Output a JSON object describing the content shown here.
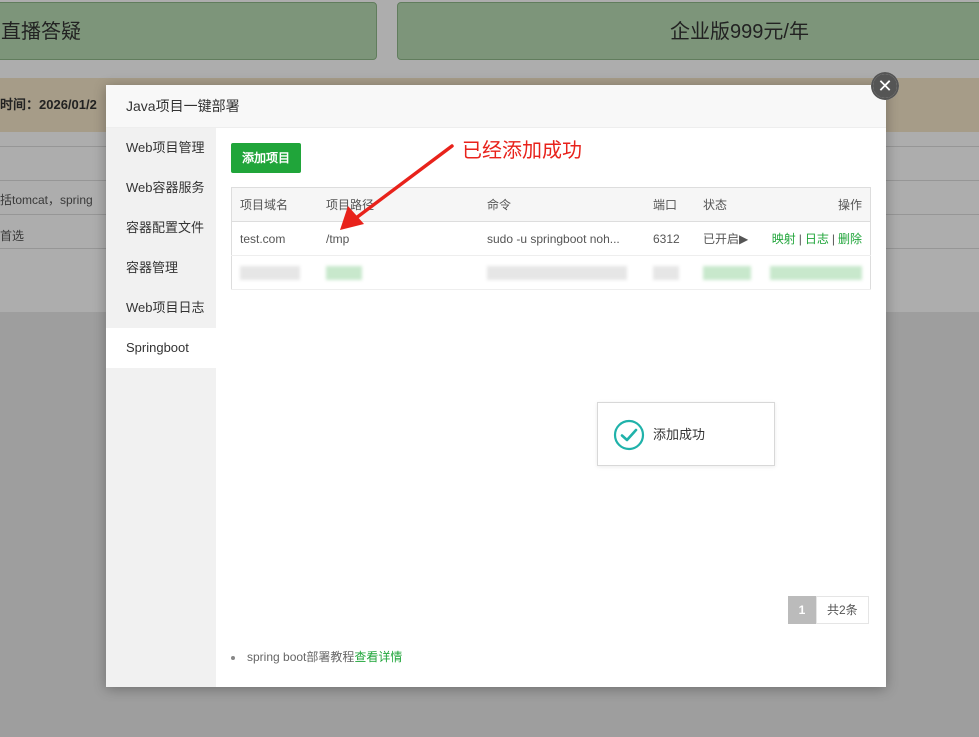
{
  "background": {
    "card1_text": "直播答疑",
    "card2_text": "企业版999元/年",
    "notice_text": "时间：2026/01/2",
    "row1_text": "括tomcat，spring",
    "row2_text": "首选"
  },
  "modal": {
    "title": "Java项目一键部署",
    "close_glyph": "✕"
  },
  "sidebar": {
    "items": [
      {
        "label": "Web项目管理"
      },
      {
        "label": "Web容器服务"
      },
      {
        "label": "容器配置文件"
      },
      {
        "label": "容器管理"
      },
      {
        "label": "Web项目日志"
      },
      {
        "label": "Springboot"
      }
    ],
    "active_index": 5
  },
  "toolbar": {
    "add_label": "添加项目"
  },
  "table": {
    "headers": {
      "domain": "项目域名",
      "path": "项目路径",
      "command": "命令",
      "port": "端口",
      "status": "状态",
      "ops": "操作"
    },
    "rows": [
      {
        "domain": "test.com",
        "path": "/tmp",
        "command": "sudo -u springboot noh...",
        "port": "6312",
        "status": "已开启▶",
        "op_map": "映射",
        "op_log": "日志",
        "op_delete": "删除",
        "sep": "|"
      }
    ]
  },
  "toast": {
    "message": "添加成功"
  },
  "pagination": {
    "current": "1",
    "total_text": "共2条"
  },
  "footer": {
    "text": "spring boot部署教程",
    "link": "查看详情"
  },
  "annotation": {
    "text": "已经添加成功"
  },
  "colors": {
    "accent_green": "#20a53a",
    "annotation_red": "#e8221b"
  }
}
